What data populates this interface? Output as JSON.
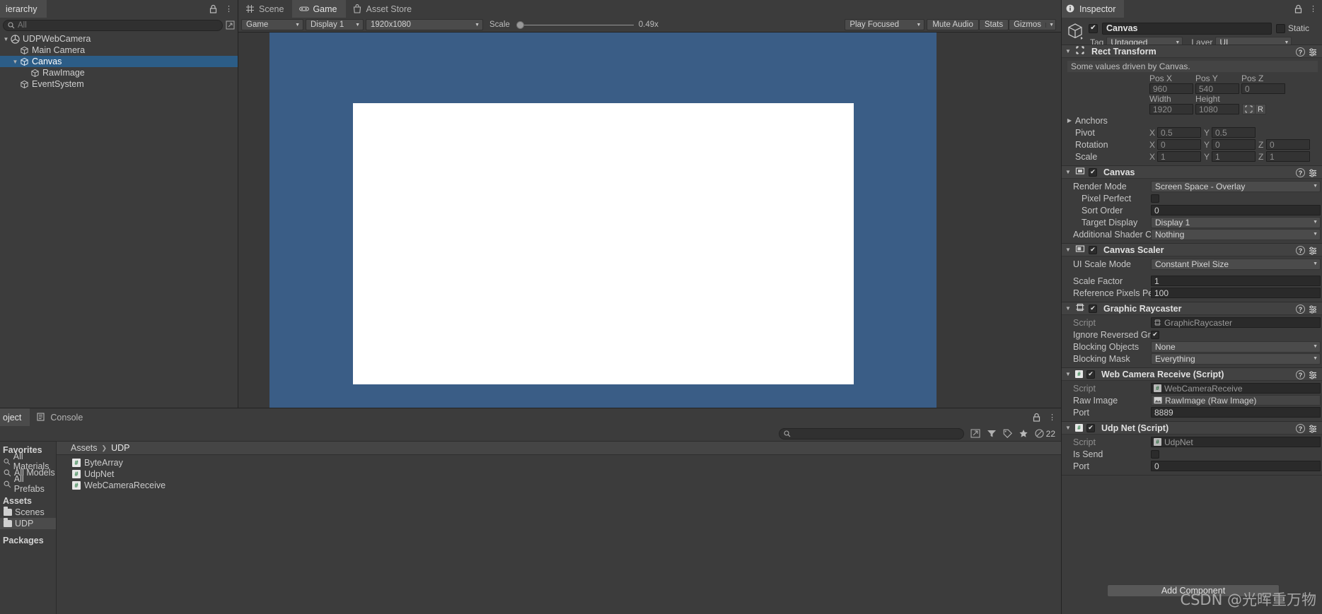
{
  "hierarchy": {
    "tab_label": "ierarchy",
    "search_placeholder": "All",
    "items": [
      {
        "label": "UDPWebCamera",
        "depth": 0,
        "icon": "unity-prefab-icon",
        "expanded": true,
        "selected": false
      },
      {
        "label": "Main Camera",
        "depth": 1,
        "icon": "gameobject-cube-icon",
        "expanded": null,
        "selected": false
      },
      {
        "label": "Canvas",
        "depth": 1,
        "icon": "gameobject-cube-icon",
        "expanded": true,
        "selected": true
      },
      {
        "label": "RawImage",
        "depth": 2,
        "icon": "gameobject-cube-icon",
        "expanded": null,
        "selected": false
      },
      {
        "label": "EventSystem",
        "depth": 1,
        "icon": "gameobject-cube-icon",
        "expanded": null,
        "selected": false
      }
    ]
  },
  "gameview": {
    "tabs": [
      {
        "label": "Scene",
        "icon": "grid-icon",
        "active": false
      },
      {
        "label": "Game",
        "icon": "gamepad-icon",
        "active": true
      },
      {
        "label": "Asset Store",
        "icon": "store-bag-icon",
        "active": false
      }
    ],
    "toolbar": {
      "view_mode": "Game",
      "display": "Display 1",
      "resolution": "1920x1080",
      "scale_label": "Scale",
      "scale_value": "0.49x",
      "play_focused": "Play Focused",
      "mute_audio": "Mute Audio",
      "stats": "Stats",
      "gizmos": "Gizmos"
    },
    "background_color": "#3a5d86",
    "raw_image_color": "#ffffff"
  },
  "project": {
    "tabs": [
      {
        "label": "oject",
        "icon": "project-icon",
        "active": true
      },
      {
        "label": "Console",
        "icon": "console-icon",
        "active": false
      }
    ],
    "search_placeholder": "",
    "count_badge": "22",
    "favorites_header": "Favorites",
    "favorites": [
      {
        "label": "All Materials",
        "icon": "search-icon"
      },
      {
        "label": "All Models",
        "icon": "search-icon"
      },
      {
        "label": "All Prefabs",
        "icon": "search-icon"
      }
    ],
    "assets_header": "Assets",
    "folders": [
      {
        "label": "Scenes",
        "icon": "folder-icon",
        "selected": false
      },
      {
        "label": "UDP",
        "icon": "folder-icon",
        "selected": true
      }
    ],
    "packages_header": "Packages",
    "breadcrumb": [
      "Assets",
      "UDP"
    ],
    "assets": [
      {
        "label": "ByteArray",
        "icon": "csharp-script-icon"
      },
      {
        "label": "UdpNet",
        "icon": "csharp-script-icon"
      },
      {
        "label": "WebCameraReceive",
        "icon": "csharp-script-icon"
      }
    ]
  },
  "inspector": {
    "tab_label": "Inspector",
    "object": {
      "enabled": true,
      "name": "Canvas",
      "static_label": "Static",
      "static_checked": false,
      "tag_label": "Tag",
      "tag_value": "Untagged",
      "layer_label": "Layer",
      "layer_value": "UI"
    },
    "components": [
      {
        "title": "Rect Transform",
        "icon": "rect-transform-icon",
        "has_checkbox": false,
        "note": "Some values driven by Canvas.",
        "col_headers_1": [
          "Pos X",
          "Pos Y",
          "Pos Z"
        ],
        "values_1": [
          "960",
          "540",
          "0"
        ],
        "col_headers_2": [
          "Width",
          "Height"
        ],
        "values_2": [
          "1920",
          "1080"
        ],
        "anchors_label": "Anchors",
        "pivot_label": "Pivot",
        "pivot": {
          "x": "0.5",
          "y": "0.5"
        },
        "rotation_label": "Rotation",
        "rotation": {
          "x": "0",
          "y": "0",
          "z": "0"
        },
        "scale_label": "Scale",
        "scale": {
          "x": "1",
          "y": "1",
          "z": "1"
        },
        "blueprint_label": "R"
      },
      {
        "title": "Canvas",
        "icon": "canvas-icon",
        "has_checkbox": true,
        "checked": true,
        "rows": [
          {
            "label": "Render Mode",
            "value": "Screen Space - Overlay",
            "type": "popup",
            "indent": 0
          },
          {
            "label": "Pixel Perfect",
            "value": "",
            "type": "checkbox",
            "checked": false,
            "indent": 1
          },
          {
            "label": "Sort Order",
            "value": "0",
            "type": "field",
            "indent": 1
          },
          {
            "label": "Target Display",
            "value": "Display 1",
            "type": "popup",
            "indent": 1
          },
          {
            "label": "Additional Shader Chan",
            "value": "Nothing",
            "type": "popup",
            "indent": 0
          }
        ]
      },
      {
        "title": "Canvas Scaler",
        "icon": "canvas-scaler-icon",
        "has_checkbox": true,
        "checked": true,
        "rows": [
          {
            "label": "UI Scale Mode",
            "value": "Constant Pixel Size",
            "type": "popup",
            "indent": 0
          },
          {
            "label": "",
            "value": "",
            "type": "spacer",
            "indent": 0
          },
          {
            "label": "Scale Factor",
            "value": "1",
            "type": "field",
            "indent": 0
          },
          {
            "label": "Reference Pixels Per Un",
            "value": "100",
            "type": "field",
            "indent": 0
          }
        ]
      },
      {
        "title": "Graphic Raycaster",
        "icon": "raycaster-icon",
        "has_checkbox": true,
        "checked": true,
        "rows": [
          {
            "label": "Script",
            "value": "GraphicRaycaster",
            "type": "object",
            "indent": 0,
            "dim": true,
            "obj_icon": "raycaster-icon"
          },
          {
            "label": "Ignore Reversed Graphic",
            "value": "",
            "type": "checkbox",
            "checked": true,
            "indent": 0
          },
          {
            "label": "Blocking Objects",
            "value": "None",
            "type": "popup",
            "indent": 0
          },
          {
            "label": "Blocking Mask",
            "value": "Everything",
            "type": "popup",
            "indent": 0
          }
        ]
      },
      {
        "title": "Web Camera Receive (Script)",
        "icon": "csharp-script-icon",
        "has_checkbox": true,
        "checked": true,
        "rows": [
          {
            "label": "Script",
            "value": "WebCameraReceive",
            "type": "object",
            "indent": 0,
            "dim": true,
            "obj_icon": "csharp-script-icon"
          },
          {
            "label": "Raw Image",
            "value": "RawImage (Raw Image)",
            "type": "object",
            "indent": 0,
            "dim": false,
            "obj_icon": "raw-image-icon"
          },
          {
            "label": "Port",
            "value": "8889",
            "type": "field",
            "indent": 0
          }
        ]
      },
      {
        "title": "Udp Net (Script)",
        "icon": "csharp-script-icon",
        "has_checkbox": true,
        "checked": true,
        "rows": [
          {
            "label": "Script",
            "value": "UdpNet",
            "type": "object",
            "indent": 0,
            "dim": true,
            "obj_icon": "csharp-script-icon"
          },
          {
            "label": "Is Send",
            "value": "",
            "type": "checkbox",
            "checked": false,
            "indent": 0
          },
          {
            "label": "Port",
            "value": "0",
            "type": "field",
            "indent": 0
          }
        ]
      }
    ],
    "add_component_label": "Add Component"
  },
  "watermark": "CSDN @光晖重万物"
}
